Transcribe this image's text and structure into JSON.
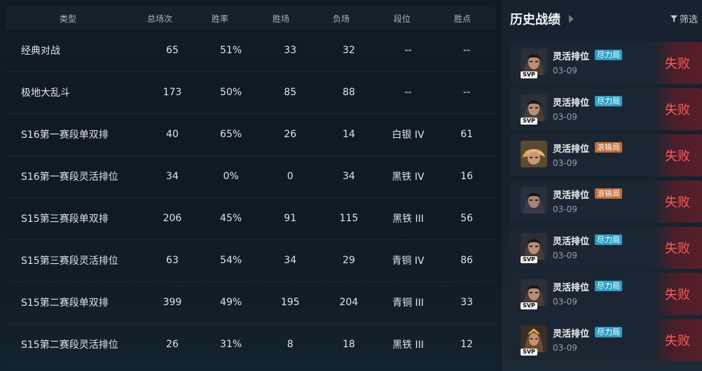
{
  "table": {
    "headers": [
      "类型",
      "总场次",
      "胜率",
      "胜场",
      "负场",
      "段位",
      "胜点"
    ],
    "rows": [
      [
        "经典对战",
        "65",
        "51%",
        "33",
        "32",
        "--",
        "--"
      ],
      [
        "极地大乱斗",
        "173",
        "50%",
        "85",
        "88",
        "--",
        "--"
      ],
      [
        "S16第一赛段单双排",
        "40",
        "65%",
        "26",
        "14",
        "白银 IV",
        "61"
      ],
      [
        "S16第一赛段灵活排位",
        "34",
        "0%",
        "0",
        "34",
        "黑铁 IV",
        "16"
      ],
      [
        "S15第三赛段单双排",
        "206",
        "45%",
        "91",
        "115",
        "黑铁 III",
        "56"
      ],
      [
        "S15第三赛段灵活排位",
        "63",
        "54%",
        "34",
        "29",
        "青铜 IV",
        "86"
      ],
      [
        "S15第二赛段单双排",
        "399",
        "49%",
        "195",
        "204",
        "青铜 III",
        "33"
      ],
      [
        "S15第二赛段灵活排位",
        "26",
        "31%",
        "8",
        "18",
        "黑铁 III",
        "12"
      ]
    ]
  },
  "history": {
    "title": "历史战绩",
    "filter_label": "筛选",
    "matches": [
      {
        "mode": "灵活排位",
        "tag": "尽力局",
        "tag_color": "#2f9fc7",
        "date": "03-09",
        "result": "失败",
        "svp": "SVP",
        "champion_icon": "dark-haired-champion-portrait"
      },
      {
        "mode": "灵活排位",
        "tag": "尽力局",
        "tag_color": "#2f9fc7",
        "date": "03-09",
        "result": "失败",
        "svp": "SVP",
        "champion_icon": "dark-haired-champion-portrait"
      },
      {
        "mode": "灵活排位",
        "tag": "浪输局",
        "tag_color": "#c06b3a",
        "date": "03-09",
        "result": "失败",
        "svp": "",
        "champion_icon": "blonde-champion-portrait"
      },
      {
        "mode": "灵活排位",
        "tag": "浪输局",
        "tag_color": "#c06b3a",
        "date": "03-09",
        "result": "失败",
        "svp": "",
        "champion_icon": "dark-haired-champion-portrait"
      },
      {
        "mode": "灵活排位",
        "tag": "尽力局",
        "tag_color": "#2f9fc7",
        "date": "03-09",
        "result": "失败",
        "svp": "SVP",
        "champion_icon": "dark-haired-champion-portrait"
      },
      {
        "mode": "灵活排位",
        "tag": "尽力局",
        "tag_color": "#2f9fc7",
        "date": "03-09",
        "result": "失败",
        "svp": "SVP",
        "champion_icon": "dark-haired-champion-portrait"
      },
      {
        "mode": "灵活排位",
        "tag": "尽力局",
        "tag_color": "#2f9fc7",
        "date": "03-09",
        "result": "失败",
        "svp": "SVP",
        "champion_icon": "warrior-champion-portrait"
      }
    ]
  }
}
